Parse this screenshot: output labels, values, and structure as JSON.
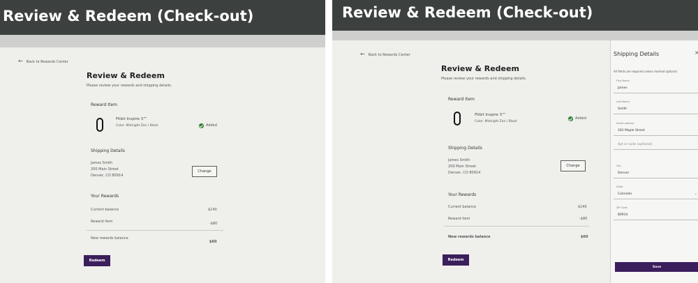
{
  "banner_title": "Review & Redeem (Check-out)",
  "page": {
    "back_link": "Back to Rewards Center",
    "heading": "Review & Redeem",
    "subheading": "Please review your rewards and shipping details.",
    "reward_item_heading": "Reward Item",
    "item_name": "Fitbit Inspire 3™",
    "item_variant": "Color: Midnight Zen / Black",
    "added_label": "Added",
    "shipping_heading": "Shipping Details",
    "address_lines": [
      "James Smith",
      "200 Main Street",
      "Denver, CO 80914"
    ],
    "change_label": "Change",
    "rewards_heading": "Your Rewards",
    "current_balance_label": "Current balance",
    "current_balance_value": "$140",
    "reward_item_label": "Reward item",
    "reward_item_value": "-$80",
    "new_balance_label": "New rewards balance",
    "new_balance_value": "$60",
    "redeem_label": "Redeem"
  },
  "drawer": {
    "title": "Shipping Details",
    "close_icon": "close-icon",
    "note": "All fields are required unless marked optional",
    "fields": {
      "first_name_label": "First Name",
      "first_name_value": "James",
      "last_name_label": "Last Name",
      "last_name_value": "Smith",
      "street_label": "Street address",
      "street_value": "181 Maple Street",
      "apt_placeholder": "Apt or suite (optional)",
      "city_label": "City",
      "city_value": "Denver",
      "state_label": "State",
      "state_value": "Colorado",
      "zip_label": "ZIP Code",
      "zip_value": "80914"
    },
    "save_label": "Save"
  },
  "colors": {
    "banner": "#3c403e",
    "primary_button": "#3b1e5c",
    "added_check": "#2e7d32"
  }
}
